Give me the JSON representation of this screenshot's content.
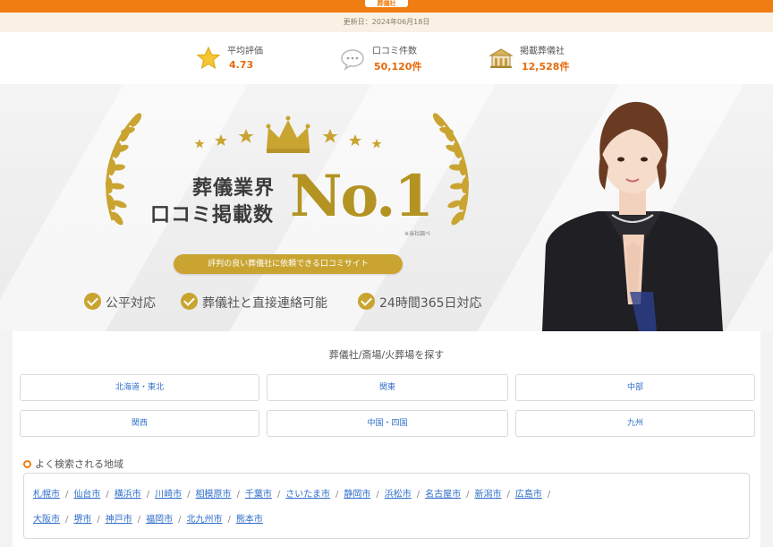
{
  "header": {
    "logo": "葬儀社"
  },
  "updated": {
    "text": "更新日：2024年06月18日"
  },
  "stats": {
    "rating": {
      "label": "平均評価",
      "value": "4.73",
      "icon": "star-icon"
    },
    "reviews": {
      "label": "口コミ件数",
      "value": "50,120件",
      "icon": "chat-icon"
    },
    "companies": {
      "label": "掲載葬儀社",
      "value": "12,528件",
      "icon": "building-icon"
    }
  },
  "hero": {
    "line1": "葬儀業界",
    "line2": "口コミ掲載数",
    "badge": "No.1",
    "note": "※当社調べ",
    "ribbon": "評判の良い葬儀社に依頼できる口コミサイト",
    "features": [
      "公平対応",
      "葬儀社と直接連絡可能",
      "24時間365日対応"
    ],
    "colors": {
      "gold": "#c9a431",
      "accent": "#ef7d12"
    }
  },
  "search": {
    "title": "葬儀社/斎場/火葬場を探す",
    "regions": [
      "北海道・東北",
      "関東",
      "中部",
      "関西",
      "中国・四国",
      "九州"
    ]
  },
  "frequent": {
    "title": "よく検索される地域",
    "row1": [
      "札幌市",
      "仙台市",
      "横浜市",
      "川崎市",
      "相模原市",
      "千葉市",
      "さいたま市",
      "静岡市",
      "浜松市",
      "名古屋市",
      "新潟市",
      "広島市"
    ],
    "row2": [
      "大阪市",
      "堺市",
      "神戸市",
      "福岡市",
      "北九州市",
      "熊本市"
    ]
  }
}
